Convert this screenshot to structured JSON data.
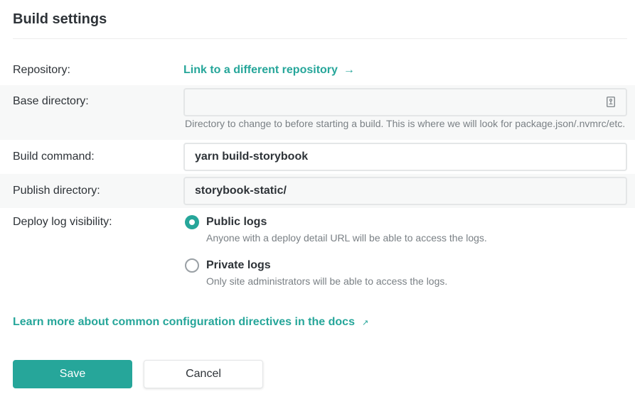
{
  "page": {
    "title": "Build settings"
  },
  "repository": {
    "label": "Repository:",
    "link_text": "Link to a different repository",
    "arrow": "→"
  },
  "base_directory": {
    "label": "Base directory:",
    "value": "",
    "icon": "file-directory-icon",
    "helper": "Directory to change to before starting a build. This is where we will look for package.json/.nvmrc/etc."
  },
  "build_command": {
    "label": "Build command:",
    "value": "yarn build-storybook"
  },
  "publish_directory": {
    "label": "Publish directory:",
    "value": "storybook-static/"
  },
  "deploy_log": {
    "label": "Deploy log visibility:",
    "options": [
      {
        "label": "Public logs",
        "description": "Anyone with a deploy detail URL will be able to access the logs.",
        "checked": true
      },
      {
        "label": "Private logs",
        "description": "Only site administrators will be able to access the logs.",
        "checked": false
      }
    ]
  },
  "docs_link": {
    "text": "Learn more about common configuration directives in the docs",
    "icon": "↗"
  },
  "buttons": {
    "save": "Save",
    "cancel": "Cancel"
  },
  "colors": {
    "accent": "#26a69a",
    "text": "#2e3338",
    "muted": "#7a8085",
    "shaded_row": "#f7f8f8",
    "border": "#e4e6e7"
  }
}
